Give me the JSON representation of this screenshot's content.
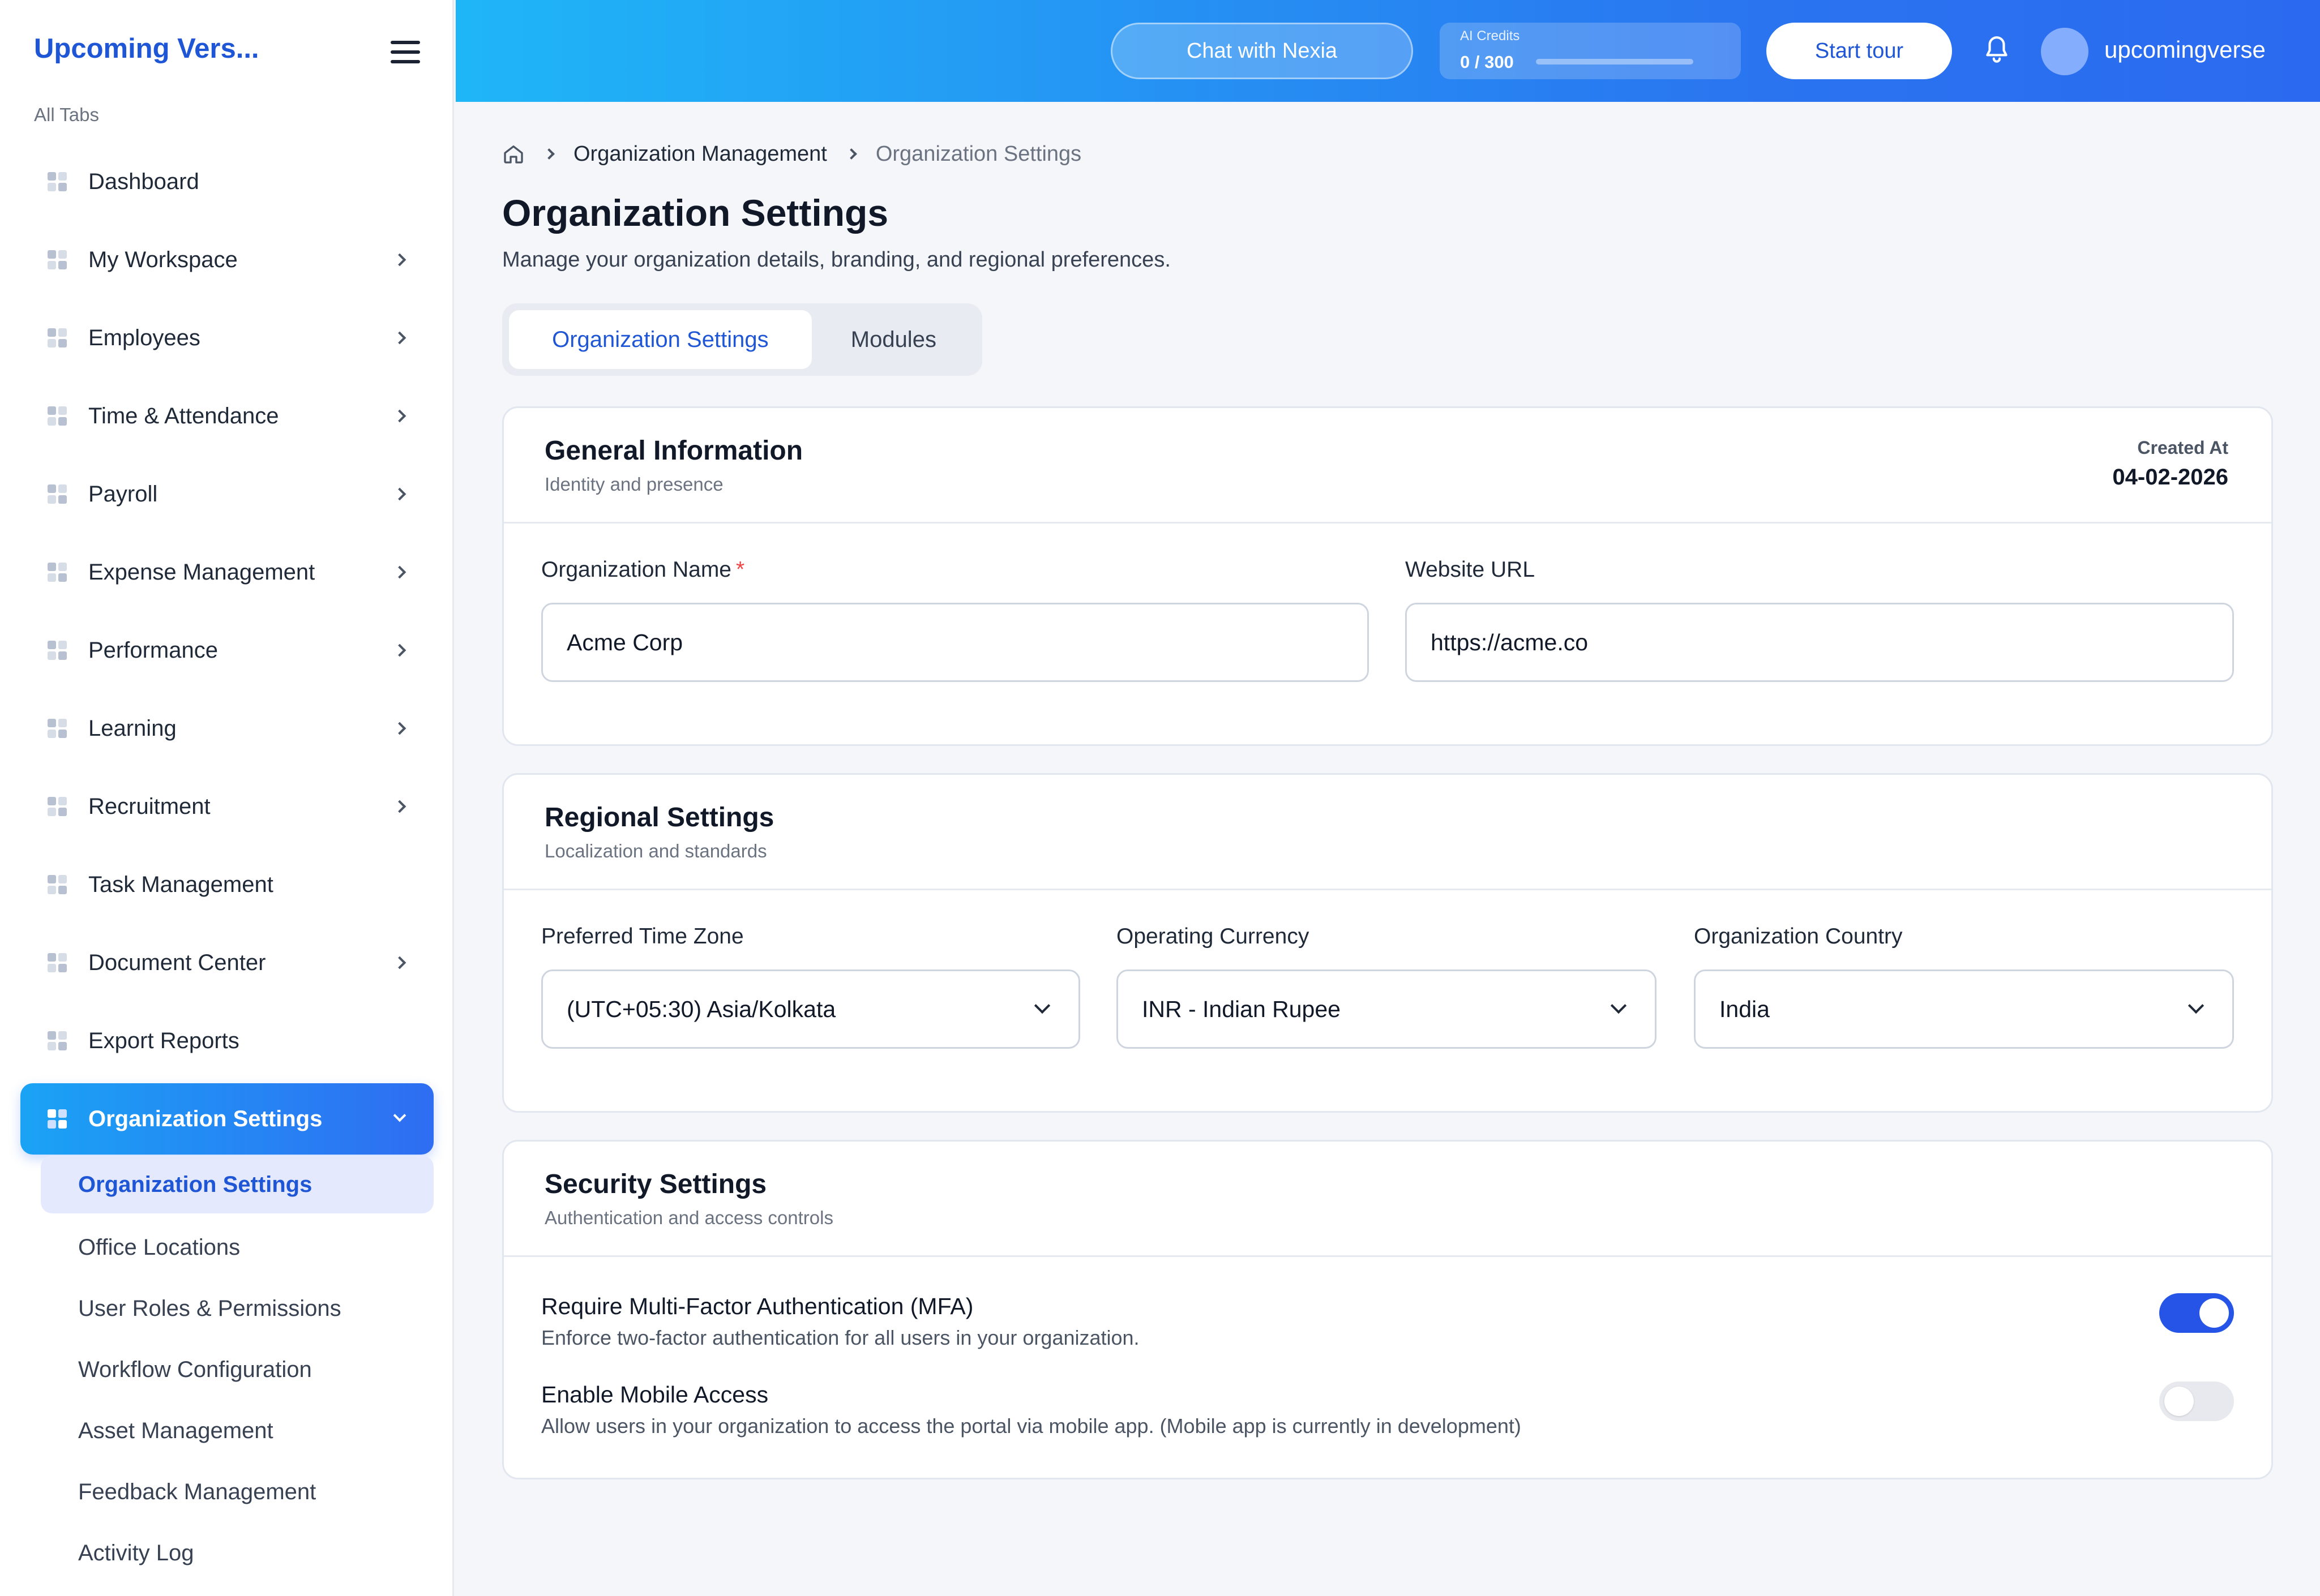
{
  "sidebar": {
    "brand": "Upcoming Vers...",
    "section_label": "All Tabs",
    "items": [
      {
        "label": "Dashboard"
      },
      {
        "label": "My Workspace"
      },
      {
        "label": "Employees"
      },
      {
        "label": "Time & Attendance"
      },
      {
        "label": "Payroll"
      },
      {
        "label": "Expense Management"
      },
      {
        "label": "Performance"
      },
      {
        "label": "Learning"
      },
      {
        "label": "Recruitment"
      },
      {
        "label": "Task Management"
      },
      {
        "label": "Document Center"
      },
      {
        "label": "Export Reports"
      },
      {
        "label": "Organization Settings"
      }
    ],
    "sub_items": [
      {
        "label": "Organization Settings"
      },
      {
        "label": "Office Locations"
      },
      {
        "label": "User Roles & Permissions"
      },
      {
        "label": "Workflow Configuration"
      },
      {
        "label": "Asset Management"
      },
      {
        "label": "Feedback Management"
      },
      {
        "label": "Activity Log"
      }
    ]
  },
  "topbar": {
    "chat_label": "Chat with Nexia",
    "credits_title": "AI Credits",
    "credits_value": "0 / 300",
    "credits_used_fraction": 0,
    "tour_label": "Start tour",
    "username": "upcomingverse"
  },
  "breadcrumb": {
    "parent": "Organization Management",
    "current": "Organization Settings"
  },
  "page": {
    "title": "Organization Settings",
    "subtitle": "Manage your organization details, branding, and regional preferences."
  },
  "tabs": [
    {
      "label": "Organization Settings"
    },
    {
      "label": "Modules"
    }
  ],
  "general": {
    "title": "General Information",
    "subtitle": "Identity and presence",
    "created_label": "Created At",
    "created_value": "04-02-2026",
    "org_name_label": "Organization Name",
    "required_mark": "*",
    "org_name_value": "Acme Corp",
    "website_label": "Website URL",
    "website_value": "https://acme.co"
  },
  "regional": {
    "title": "Regional Settings",
    "subtitle": "Localization and standards",
    "timezone_label": "Preferred Time Zone",
    "timezone_value": "(UTC+05:30) Asia/Kolkata",
    "currency_label": "Operating Currency",
    "currency_value": "INR - Indian Rupee",
    "country_label": "Organization Country",
    "country_value": "India"
  },
  "security": {
    "title": "Security Settings",
    "subtitle": "Authentication and access controls",
    "mfa_title": "Require Multi-Factor Authentication (MFA)",
    "mfa_desc": "Enforce two-factor authentication for all users in your organization.",
    "mfa_enabled": true,
    "mobile_title": "Enable Mobile Access",
    "mobile_desc": "Allow users in your organization to access the portal via mobile app. (Mobile app is currently in development)",
    "mobile_enabled": false
  },
  "colors": {
    "accent": "#1f56d6",
    "toggle_on": "#2554e6",
    "required": "#ef4444"
  }
}
